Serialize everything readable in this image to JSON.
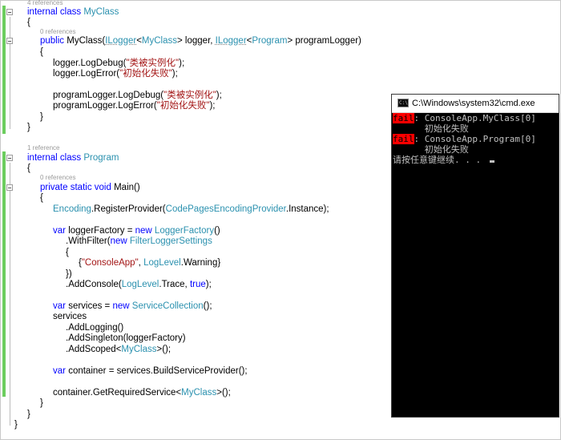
{
  "editor": {
    "lens_myclass": "4 references",
    "lens_ctor": "0 references",
    "lens_program": "1 reference",
    "lens_main": "0 references",
    "kw_internal": "internal",
    "kw_class": "class",
    "name_myclass": "MyClass",
    "brace_open": "{",
    "brace_close": "}",
    "kw_public": "public",
    "ctor_name": "MyClass(",
    "type_ilogger": "ILogger",
    "lt": "<",
    "gt_logger": "> logger, ",
    "gt_programlogger": "> programLogger)",
    "name_program": "Program",
    "log_debug": "logger.LogDebug(",
    "log_error": "logger.LogError(",
    "plog_debug": "programLogger.LogDebug(",
    "plog_error": "programLogger.LogError(",
    "str_ctor": "\"类被实例化\"",
    "str_init_fail": "\"初始化失败\"",
    "close_semi": ");",
    "kw_private": "private",
    "kw_static": "static",
    "kw_void": "void",
    "main_sig": "Main()",
    "type_encoding": "Encoding",
    "register_provider": ".RegisterProvider(",
    "type_codepages": "CodePagesEncodingProvider",
    "instance_end": ".Instance);",
    "kw_var": "var",
    "logger_factory_assign": "loggerFactory = ",
    "kw_new": "new",
    "type_loggerfactory": "LoggerFactory",
    "parens": "()",
    "with_filter": ".WithFilter(",
    "type_filtersettings": "FilterLoggerSettings",
    "open_curly_quote": "{",
    "str_consoleapp": "\"ConsoleApp\"",
    "comma_space": ", ",
    "type_loglevel": "LogLevel",
    "warning_end": ".Warning}",
    "close_filter": "})",
    "add_console": ".AddConsole(",
    "trace": ".Trace, ",
    "kw_true": "true",
    "services_assign": "services = ",
    "type_servicecollection": "ServiceCollection",
    "parens_semi": "();",
    "services": "services",
    "add_logging": ".AddLogging()",
    "add_singleton": ".AddSingleton(loggerFactory)",
    "add_scoped": ".AddScoped<",
    "gt_parens_semi": ">();",
    "container_assign": "container = services.BuildServiceProvider();",
    "get_required": "container.GetRequiredService<"
  },
  "console": {
    "title": "C:\\Windows\\system32\\cmd.exe",
    "icon_text": "C:\\",
    "lines": [
      {
        "badge": "fail",
        "text": ": ConsoleApp.MyClass[0]"
      },
      {
        "badge": "",
        "text": "      初始化失败"
      },
      {
        "badge": "fail",
        "text": ": ConsoleApp.Program[0]"
      },
      {
        "badge": "",
        "text": "      初始化失败"
      },
      {
        "badge": "",
        "text": "请按任意键继续. . . "
      }
    ]
  },
  "colors": {
    "keyword": "#0000ff",
    "type": "#2b91af",
    "string": "#a31515",
    "change_bar": "#6ccd5e",
    "console_bg": "#000000",
    "fail_badge": "#ff0000"
  }
}
